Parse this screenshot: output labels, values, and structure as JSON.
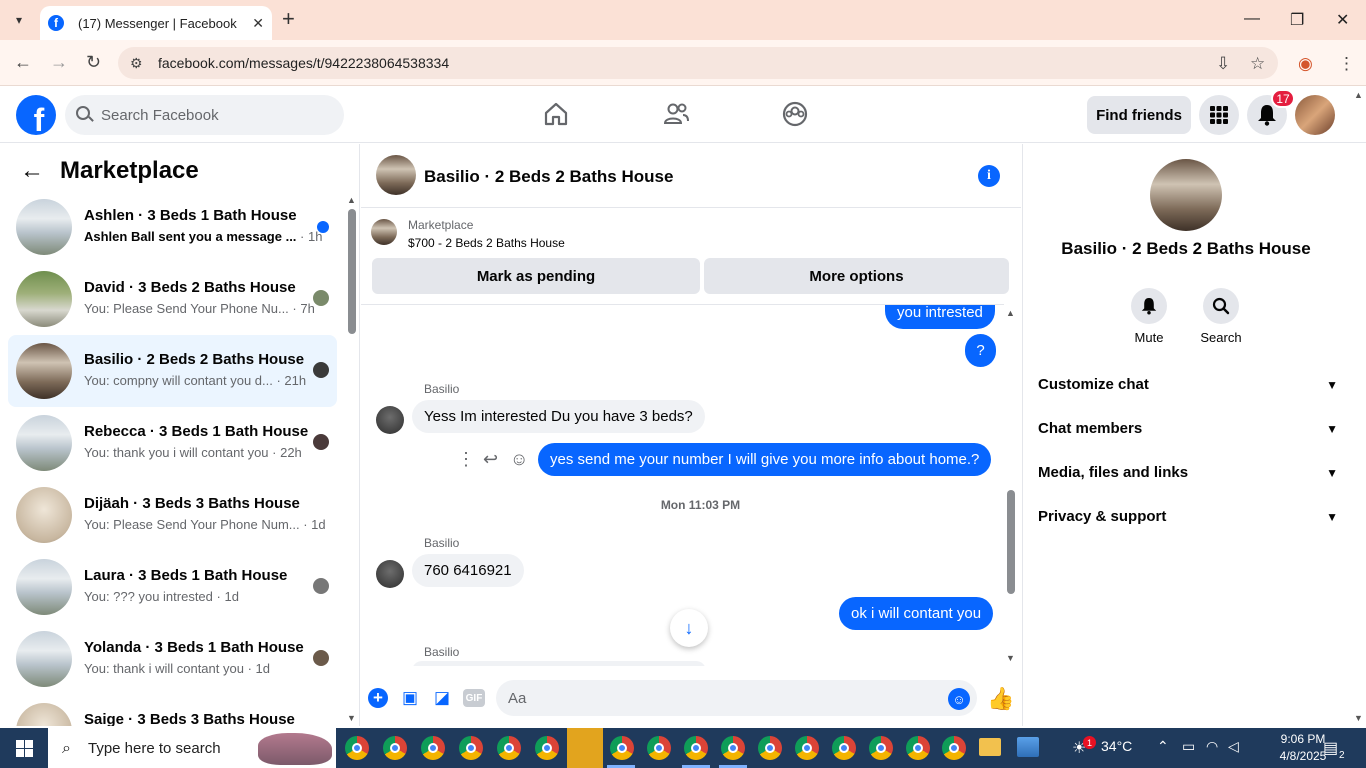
{
  "browser": {
    "tab_title": "(17) Messenger | Facebook",
    "url": "facebook.com/messages/t/9422238064538334"
  },
  "fb_header": {
    "search_placeholder": "Search Facebook",
    "find_friends": "Find friends",
    "notif_count": "17"
  },
  "sidebar": {
    "title": "Marketplace",
    "conversations": [
      {
        "name": "Ashlen · 3 Beds 1 Bath House",
        "snippet": "Ashlen Ball sent you a message ...",
        "time": " · 1h",
        "unread": true
      },
      {
        "name": "David · 3 Beds 2 Baths House",
        "snippet": "You: Please Send Your Phone Nu...",
        "time": " · 7h"
      },
      {
        "name": "Basilio · 2 Beds 2 Baths House",
        "snippet": "You: compny will contant you d...",
        "time": " · 21h",
        "active": true
      },
      {
        "name": "Rebecca · 3 Beds 1 Bath House",
        "snippet": "You: thank you i will contant you",
        "time": " · 22h"
      },
      {
        "name": "Dijäah · 3 Beds 3 Baths House",
        "snippet": "You: Please Send Your Phone Num...",
        "time": " · 1d"
      },
      {
        "name": "Laura · 3 Beds 1 Bath House",
        "snippet": "You: ??? you intrested",
        "time": " · 1d"
      },
      {
        "name": "Yolanda · 3 Beds 1 Bath House",
        "snippet": "You: thank i will contant you",
        "time": " · 1d"
      },
      {
        "name": "Saige · 3 Beds 3 Baths House",
        "snippet": "",
        "time": ""
      }
    ]
  },
  "chat": {
    "title": "Basilio · 2 Beds 2 Baths House",
    "marketplace_label": "Marketplace",
    "listing": "$700 - 2 Beds 2 Baths House",
    "mark_pending": "Mark as pending",
    "more_options": "More options",
    "messages": {
      "out_1": "you intrested",
      "out_2": "?",
      "sender_1": "Basilio",
      "in_1": "Yess Im interested Du you have 3 beds?",
      "out_3": "yes send me your number  I will give you more info about home.?",
      "timestamp": "Mon 11:03 PM",
      "sender_2": "Basilio",
      "in_2": "760 6416921",
      "out_4": "ok i will contant you",
      "sender_3": "Basilio"
    },
    "composer_placeholder": "Aa"
  },
  "right_panel": {
    "title": "Basilio · 2 Beds 2 Baths House",
    "mute": "Mute",
    "search": "Search",
    "sections": [
      "Customize chat",
      "Chat members",
      "Media, files and links",
      "Privacy & support"
    ]
  },
  "taskbar": {
    "search_placeholder": "Type here to search",
    "weather": "34°C",
    "time": "9:06 PM",
    "date": "4/8/2025",
    "notif_count": "1",
    "action_center_count": "2"
  }
}
